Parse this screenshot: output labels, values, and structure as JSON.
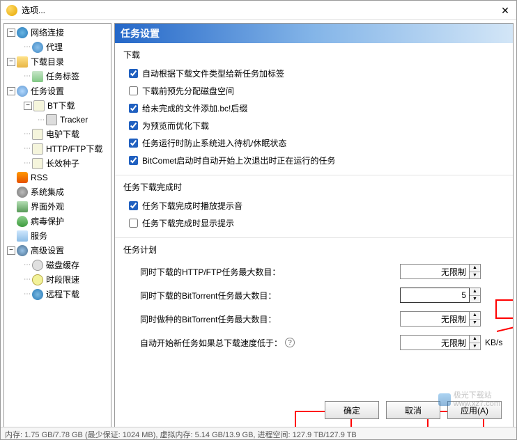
{
  "window": {
    "title": "选项..."
  },
  "sidebar": {
    "items": [
      {
        "label": "网络连接"
      },
      {
        "label": "代理"
      },
      {
        "label": "下载目录"
      },
      {
        "label": "任务标签"
      },
      {
        "label": "任务设置"
      },
      {
        "label": "BT下载"
      },
      {
        "label": "Tracker"
      },
      {
        "label": "电驴下载"
      },
      {
        "label": "HTTP/FTP下载"
      },
      {
        "label": "长效种子"
      },
      {
        "label": "RSS"
      },
      {
        "label": "系统集成"
      },
      {
        "label": "界面外观"
      },
      {
        "label": "病毒保护"
      },
      {
        "label": "服务"
      },
      {
        "label": "高级设置"
      },
      {
        "label": "磁盘缓存"
      },
      {
        "label": "时段限速"
      },
      {
        "label": "远程下载"
      }
    ]
  },
  "content": {
    "header": "任务设置",
    "sections": {
      "download": {
        "label": "下载",
        "chk1": "自动根据下载文件类型给新任务加标签",
        "chk2": "下载前预先分配磁盘空间",
        "chk3": "给未完成的文件添加.bc!后缀",
        "chk4": "为预览而优化下载",
        "chk5": "任务运行时防止系统进入待机/休眠状态",
        "chk6": "BitComet启动时自动开始上次退出时正在运行的任务"
      },
      "completion": {
        "label": "任务下载完成时",
        "chk1": "任务下载完成时播放提示音",
        "chk2": "任务下载完成时显示提示"
      },
      "plan": {
        "label": "任务计划",
        "f1": "同时下载的HTTP/FTP任务最大数目：",
        "f1v": "无限制",
        "f2": "同时下载的BitTorrent任务最大数目：",
        "f2v": "5",
        "f3": "同时做种的BitTorrent任务最大数目：",
        "f3v": "无限制",
        "f4": "自动开始新任务如果总下载速度低于：",
        "f4v": "无限制",
        "unit": "KB/s"
      }
    }
  },
  "buttons": {
    "ok": "确定",
    "cancel": "取消",
    "apply": "应用(A)"
  },
  "statusbar": "内存: 1.75 GB/7.78 GB (最少保证: 1024 MB), 虚拟内存: 5.14 GB/13.9 GB, 进程空间: 127.9 TB/127.9 TB",
  "watermark": "极光下载站\nwww.xz7.com",
  "toggle": {
    "minus": "−",
    "plus": "+"
  }
}
